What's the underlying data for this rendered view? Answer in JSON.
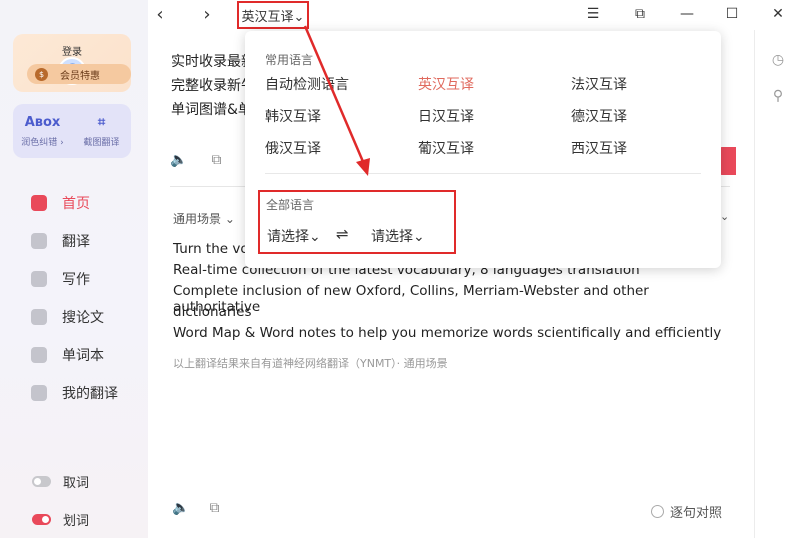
{
  "sidebar": {
    "login_label": "登录",
    "vip_label": "会员特惠",
    "vip_coin": "$",
    "tools": [
      {
        "icon": "Aʙox",
        "label": "润色纠错 ›"
      },
      {
        "icon": "⌗",
        "label": "截图翻译"
      }
    ],
    "nav": [
      {
        "label": "首页",
        "icon": "home-icon",
        "active": true
      },
      {
        "label": "翻译",
        "icon": "translate-icon",
        "active": false
      },
      {
        "label": "写作",
        "icon": "write-icon",
        "active": false
      },
      {
        "label": "搜论文",
        "icon": "paper-icon",
        "active": false
      },
      {
        "label": "单词本",
        "icon": "wordbook-icon",
        "active": false
      },
      {
        "label": "我的翻译",
        "icon": "my-translation-icon",
        "active": false
      }
    ],
    "toggles": [
      {
        "label": "取词",
        "on": false
      },
      {
        "label": "划词",
        "on": true
      }
    ]
  },
  "topbar": {
    "back": "‹",
    "forward": "›",
    "language_selector": "英汉互译⌄",
    "menu": "☰",
    "mini": "⧉",
    "minimize": "—",
    "maximize": "☐",
    "close": "✕"
  },
  "right_strip": {
    "history": "◷",
    "settings": "⚲"
  },
  "source": {
    "lines": [
      "实时收录最新",
      "完整收录新牛",
      "单词图谱&单"
    ]
  },
  "result": {
    "scene": "通用场景 ⌄",
    "scene_caret": "⌄",
    "lines": [
      "Turn the vo",
      "Real-time collection of the latest vocabulary, 8 languages translation",
      "Complete inclusion of new Oxford, Collins, Merriam-Webster and other authoritative",
      "dictionaries",
      "Word Map & Word notes to help you memorize words scientifically and efficiently"
    ],
    "credit": "以上翻译结果来自有道神经网络翻译（YNMT）· 通用场景",
    "compare": "逐句对照"
  },
  "dropdown": {
    "common_title": "常用语言",
    "languages": [
      [
        "自动检测语言",
        "英汉互译",
        "法汉互译"
      ],
      [
        "韩汉互译",
        "日汉互译",
        "德汉互译"
      ],
      [
        "俄汉互译",
        "葡汉互译",
        "西汉互译"
      ]
    ],
    "selected": "英汉互译",
    "all_title": "全部语言",
    "from_pick": "请选择⌄",
    "to_pick": "请选择⌄",
    "swap": "⇌"
  },
  "colors": {
    "accent": "#e9495a",
    "highlight_box": "#e02a2a",
    "selected_lang": "#e06a5e"
  }
}
